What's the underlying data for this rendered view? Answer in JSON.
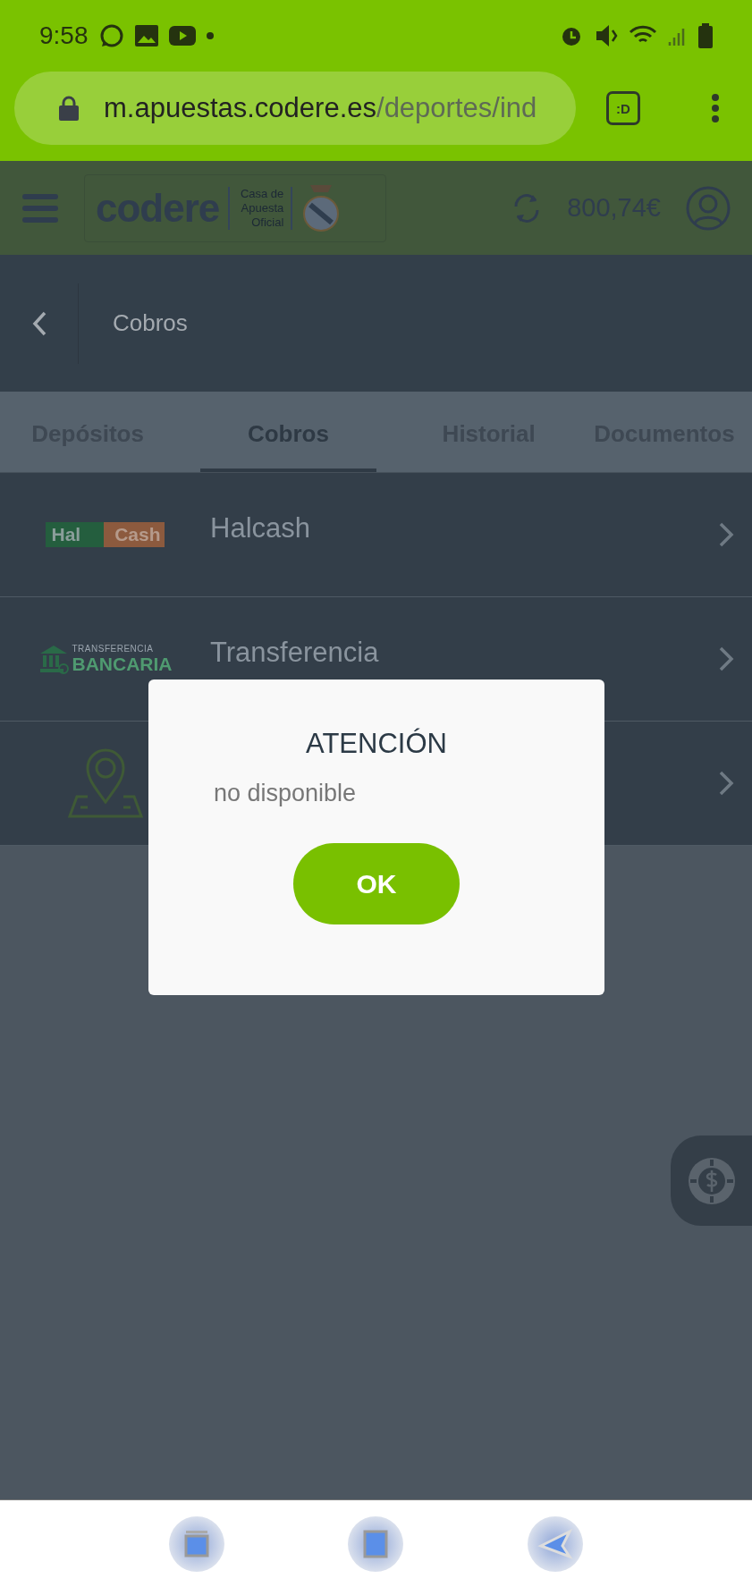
{
  "status_bar": {
    "time": "9:58"
  },
  "browser": {
    "url_host": "m.apuestas.codere.es",
    "url_path": "/deportes/ind",
    "tab_badge": ":D"
  },
  "header": {
    "logo": "codere",
    "logo_tagline": "Casa de Apuesta Oficial",
    "balance": "800,74€"
  },
  "page": {
    "title": "Cobros"
  },
  "tabs": [
    {
      "label": "Depósitos",
      "selected": false
    },
    {
      "label": "Cobros",
      "selected": true
    },
    {
      "label": "Historial",
      "selected": false
    },
    {
      "label": "Documentos",
      "selected": false
    }
  ],
  "methods": [
    {
      "kind": "halcash",
      "logo_left": "Hal",
      "logo_right": "Cash",
      "label": "Halcash"
    },
    {
      "kind": "bank",
      "logo_top": "TRANSFERENCIA",
      "logo_bottom": "BANCARIA",
      "label": "Transferencia"
    },
    {
      "kind": "location"
    }
  ],
  "dialog": {
    "title": "ATENCIÓN",
    "message": "no disponible",
    "button": "OK"
  }
}
